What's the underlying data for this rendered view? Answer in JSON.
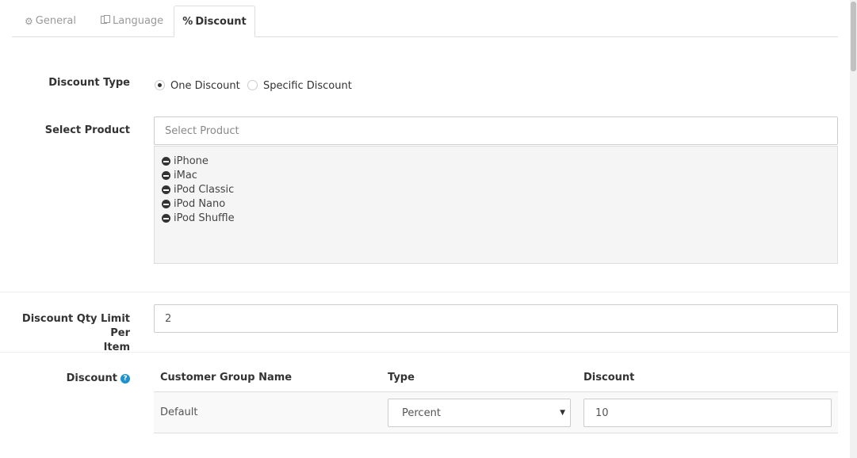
{
  "tabs": [
    {
      "label": "General",
      "icon": "gear-icon"
    },
    {
      "label": "Language",
      "icon": "language-icon"
    },
    {
      "label": "Discount",
      "icon": "percent-icon"
    }
  ],
  "discount_type": {
    "label": "Discount Type",
    "options": [
      "One Discount",
      "Specific Discount"
    ],
    "selected": "One Discount"
  },
  "select_product": {
    "label": "Select Product",
    "placeholder": "Select Product",
    "items": [
      "iPhone",
      "iMac",
      "iPod Classic",
      "iPod Nano",
      "iPod Shuffle"
    ]
  },
  "qty_limit": {
    "label_line1": "Discount Qty Limit Per",
    "label_line2": "Item",
    "value": "2"
  },
  "discount_table": {
    "label": "Discount",
    "help_icon": "?",
    "headers": [
      "Customer Group Name",
      "Type",
      "Discount"
    ],
    "rows": [
      {
        "group": "Default",
        "type": "Percent",
        "discount": "10"
      }
    ]
  },
  "colors": {
    "accent": "#1e91cf",
    "well_bg": "#f5f5f5",
    "border": "#cccccc"
  }
}
